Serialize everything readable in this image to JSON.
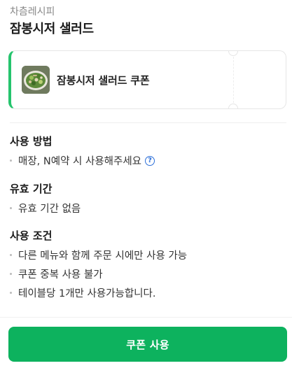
{
  "header": {
    "brand": "차츰레시피",
    "title": "잠봉시저 샐러드"
  },
  "coupon": {
    "name": "잠봉시저 샐러드 쿠폰",
    "thumbnail_icon": "salad-image",
    "accent_color": "#25c46d"
  },
  "sections": {
    "usage": {
      "heading": "사용 방법",
      "items": [
        "매장, N예약 시 사용해주세요"
      ],
      "help_icon": "question-circle-icon"
    },
    "validity": {
      "heading": "유효 기간",
      "items": [
        "유효 기간 없음"
      ]
    },
    "conditions": {
      "heading": "사용 조건",
      "items": [
        "다른 메뉴와 함께 주문 시에만 사용 가능",
        "쿠폰 중복 사용 불가",
        "테이블당 1개만 사용가능합니다."
      ]
    }
  },
  "footer": {
    "use_button_label": "쿠폰 사용",
    "button_color": "#0db25e"
  }
}
